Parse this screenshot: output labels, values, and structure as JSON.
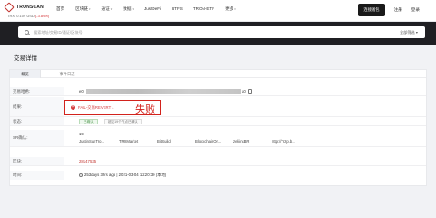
{
  "header": {
    "logo_text": "TRONSCAN",
    "price_label": "TRX: 0.109 USD",
    "price_change": "(-3.89%)",
    "nav": [
      "首页",
      "区块链",
      "通证",
      "数据",
      "JustDeFi",
      "BTFS",
      "TRON-ETF",
      "更多"
    ],
    "nav_dropdown": [
      false,
      true,
      true,
      true,
      false,
      false,
      false,
      true
    ],
    "primary_button": "连接钱包",
    "links": [
      "注册",
      "登录"
    ]
  },
  "search": {
    "placeholder": "搜索地址/交易ID/通证/区块号",
    "scope_label": "全部筛选",
    "scope_chevron": "▾"
  },
  "page_title": "交易详情",
  "tabs": [
    "概览",
    "事件日志"
  ],
  "labels": {
    "hash": "交易哈希:",
    "result": "结果:",
    "status": "状态:",
    "sr": "SR确认:",
    "block": "区块:",
    "time": "时间:"
  },
  "values": {
    "hash_prefix": "e0",
    "hash_suffix": "a0",
    "result_text": "FAIL-交易REVERT",
    "result_chevron": "›",
    "result_annotation": "失败",
    "status_badge": "已确认",
    "status_note": "超过19个节点已确认",
    "sr_count": "19",
    "sr_list": [
      "JustinSunTro...",
      "TRXMarket",
      "BitGuild",
      "BlockchainOr...",
      "zeliinsBR",
      "http://Trzp.b..."
    ],
    "block_number": "28147535",
    "time_text": "253days 3hrs ago | 2021-03-04 12:20:30 (本地)"
  },
  "colors": {
    "brand_red": "#c23631",
    "fail_red": "#d2221c",
    "dark_band": "#1f1f23"
  }
}
